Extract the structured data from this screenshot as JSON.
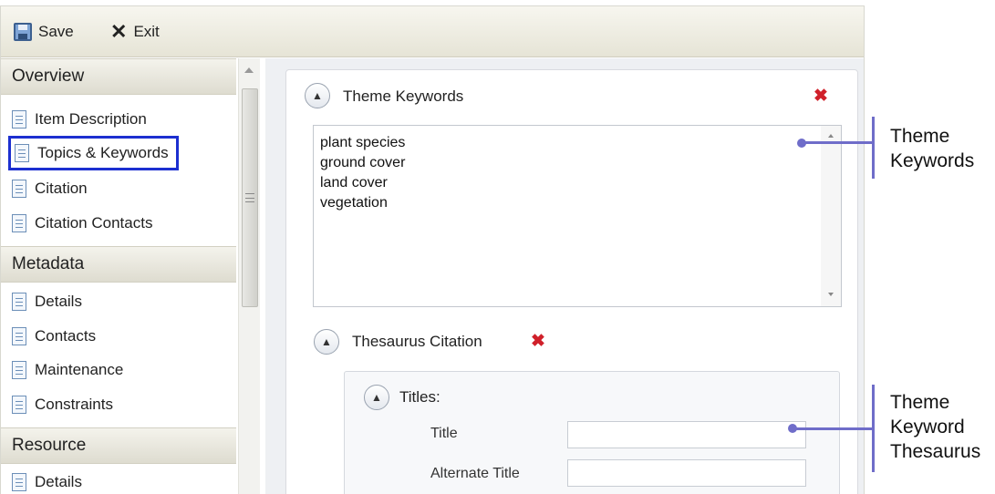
{
  "toolbar": {
    "save_label": "Save",
    "exit_label": "Exit",
    "exit_glyph": "✕"
  },
  "nav": {
    "sections": [
      {
        "title": "Overview",
        "items": [
          "Item Description",
          "Topics & Keywords",
          "Citation",
          "Citation Contacts"
        ]
      },
      {
        "title": "Metadata",
        "items": [
          "Details",
          "Contacts",
          "Maintenance",
          "Constraints"
        ]
      },
      {
        "title": "Resource",
        "items": [
          "Details"
        ]
      }
    ],
    "selected_item": "Topics & Keywords",
    "selected_color": "#1c2fd0"
  },
  "panel": {
    "theme_keywords_title": "Theme Keywords",
    "keywords": [
      "plant species",
      "ground cover",
      "land cover",
      "vegetation"
    ],
    "thesaurus_title": "Thesaurus Citation",
    "titles_label": "Titles:",
    "title_label": "Title",
    "title_value": "",
    "alternate_title_label": "Alternate Title",
    "alternate_title_value": "",
    "remove_glyph": "✖",
    "remove_color": "#d0202a"
  },
  "annotations": {
    "theme_keywords": [
      "Theme",
      "Keywords"
    ],
    "theme_keyword_thesaurus": [
      "Theme",
      "Keyword",
      "Thesaurus"
    ],
    "callout_color": "#6f6dc9"
  }
}
